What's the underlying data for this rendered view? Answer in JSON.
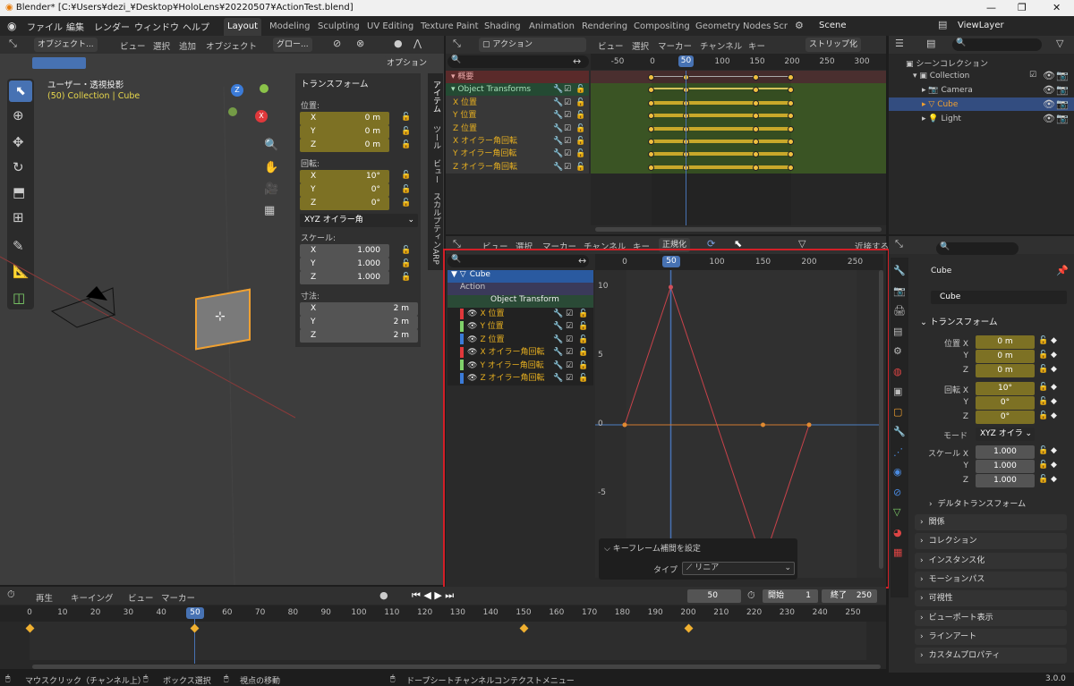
{
  "window": {
    "title": "Blender* [C:¥Users¥dezi_¥Desktop¥HoloLens¥20220507¥ActionTest.blend]",
    "min": "—",
    "max": "❐",
    "close": "✕"
  },
  "menu": [
    "ファイル",
    "編集",
    "レンダー",
    "ウィンドウ",
    "ヘルプ"
  ],
  "workspaces": [
    "Layout",
    "Modeling",
    "Sculpting",
    "UV Editing",
    "Texture Paint",
    "Shading",
    "Animation",
    "Rendering",
    "Compositing",
    "Geometry Nodes",
    "Scr"
  ],
  "scene": "Scene",
  "viewlayer": "ViewLayer",
  "viewport": {
    "mode": "オブジェクト...",
    "menus": [
      "ビュー",
      "選択",
      "追加",
      "オブジェクト"
    ],
    "orient": "グロー...",
    "options": "オプション",
    "view_label": "ユーザー・透視投影",
    "collection_label": "(50) Collection | Cube",
    "tabs": [
      "アイテム",
      "ツール",
      "ビュー",
      "スカルプティン",
      "ARP"
    ]
  },
  "npanel": {
    "header": "トランスフォーム",
    "loc_label": "位置:",
    "rot_label": "回転:",
    "scale_label": "スケール:",
    "dim_label": "寸法:",
    "loc": [
      {
        "a": "X",
        "v": "0 m"
      },
      {
        "a": "Y",
        "v": "0 m"
      },
      {
        "a": "Z",
        "v": "0 m"
      }
    ],
    "rot": [
      {
        "a": "X",
        "v": "10°"
      },
      {
        "a": "Y",
        "v": "0°"
      },
      {
        "a": "Z",
        "v": "0°"
      }
    ],
    "rot_mode": "XYZ オイラー角",
    "scale": [
      {
        "a": "X",
        "v": "1.000"
      },
      {
        "a": "Y",
        "v": "1.000"
      },
      {
        "a": "Z",
        "v": "1.000"
      }
    ],
    "dim": [
      {
        "a": "X",
        "v": "2 m"
      },
      {
        "a": "Y",
        "v": "2 m"
      },
      {
        "a": "Z",
        "v": "2 m"
      }
    ]
  },
  "dopesheet": {
    "mode": "アクション",
    "menus": [
      "ビュー",
      "選択",
      "マーカー",
      "チャンネル",
      "キー"
    ],
    "strip": "ストリップ化",
    "ruler": [
      "-50",
      "0",
      "50",
      "100",
      "150",
      "200",
      "250",
      "300"
    ],
    "channels": [
      "概要",
      "Object Transforms",
      "X 位置",
      "Y 位置",
      "Z 位置",
      "X オイラー角回転",
      "Y オイラー角回転",
      "Z オイラー角回転"
    ]
  },
  "graph": {
    "menus": [
      "ビュー",
      "選択",
      "マーカー",
      "チャンネル",
      "キー"
    ],
    "normalize": "正規化",
    "nearest": "近接する",
    "ruler": [
      "0",
      "50",
      "100",
      "150",
      "200",
      "250"
    ],
    "yaxis": [
      "10",
      "5",
      "0",
      "-5"
    ],
    "channels": {
      "object": "Cube",
      "action": "Action",
      "group": "Object Transform",
      "items": [
        "X 位置",
        "Y 位置",
        "Z 位置",
        "X オイラー角回転",
        "Y オイラー角回転",
        "Z オイラー角回転"
      ]
    },
    "popup": {
      "title": "キーフレーム補間を設定",
      "label": "タイプ",
      "value": "リニア"
    }
  },
  "chart_data": {
    "type": "line",
    "series": [
      {
        "name": "X オイラー角回転",
        "points": [
          [
            0,
            0
          ],
          [
            50,
            10
          ],
          [
            150,
            -10
          ],
          [
            200,
            0
          ]
        ]
      },
      {
        "name": "X 位置",
        "points": [
          [
            0,
            0
          ],
          [
            150,
            0
          ],
          [
            200,
            0
          ]
        ]
      }
    ],
    "xlim": [
      -30,
      280
    ],
    "ylim": [
      -13,
      11
    ]
  },
  "outliner": {
    "root": "シーンコレクション",
    "items": [
      "Collection",
      "Camera",
      "Cube",
      "Light"
    ]
  },
  "props": {
    "object": "Cube",
    "data": "Cube",
    "transform": "トランスフォーム",
    "loc": [
      {
        "a": "位置 X",
        "v": "0 m"
      },
      {
        "a": "Y",
        "v": "0 m"
      },
      {
        "a": "Z",
        "v": "0 m"
      }
    ],
    "rot": [
      {
        "a": "回転 X",
        "v": "10°"
      },
      {
        "a": "Y",
        "v": "0°"
      },
      {
        "a": "Z",
        "v": "0°"
      }
    ],
    "mode_label": "モード",
    "mode": "XYZ オイラ",
    "scale": [
      {
        "a": "スケール X",
        "v": "1.000"
      },
      {
        "a": "Y",
        "v": "1.000"
      },
      {
        "a": "Z",
        "v": "1.000"
      }
    ],
    "sections": [
      "デルタトランスフォーム",
      "関係",
      "コレクション",
      "インスタンス化",
      "モーションパス",
      "可視性",
      "ビューポート表示",
      "ラインアート",
      "カスタムプロパティ"
    ]
  },
  "timeline": {
    "menus": [
      "再生",
      "キーイング",
      "ビュー",
      "マーカー"
    ],
    "frame": "50",
    "start_label": "開始",
    "start": "1",
    "end_label": "終了",
    "end": "250",
    "ruler": [
      "0",
      "10",
      "20",
      "30",
      "40",
      "50",
      "60",
      "70",
      "80",
      "90",
      "100",
      "110",
      "120",
      "130",
      "140",
      "150",
      "160",
      "170",
      "180",
      "190",
      "200",
      "210",
      "220",
      "230",
      "240",
      "250"
    ]
  },
  "status": {
    "left": "マウスクリック（チャンネル上）",
    "mid": "ボックス選択",
    "move": "視点の移動",
    "context": "ドープシートチャンネルコンテクストメニュー",
    "version": "3.0.0"
  },
  "colors": {
    "highlight": "#d21f27",
    "accent": "#4772b3",
    "keyframe": "#f0c040"
  }
}
